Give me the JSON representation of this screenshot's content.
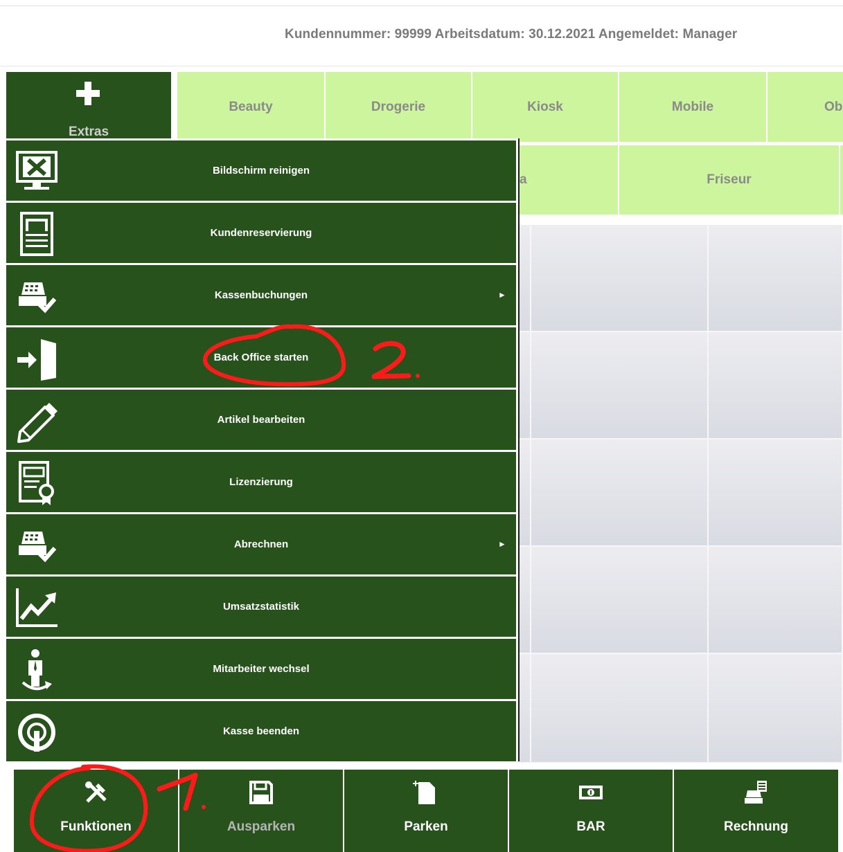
{
  "header": {
    "text": "Kundennummer: 99999 Arbeitsdatum: 30.12.2021 Angemeldet: Manager"
  },
  "extras": {
    "label": "Extras",
    "icon": "plus-icon"
  },
  "categories": {
    "row1": [
      "Beauty",
      "Drogerie",
      "Kiosk",
      "Mobile",
      "Ob"
    ],
    "row2": [
      "a",
      "Friseur"
    ]
  },
  "menu": {
    "items": [
      {
        "label": "Bildschirm reinigen",
        "icon": "screen-clean-icon"
      },
      {
        "label": "Kundenreservierung",
        "icon": "reservation-document-icon"
      },
      {
        "label": "Kassenbuchungen",
        "icon": "cash-register-check-icon",
        "submenu_arrow": "►"
      },
      {
        "label": "Back Office starten",
        "icon": "enter-door-icon"
      },
      {
        "label": "Artikel bearbeiten",
        "icon": "pencil-icon"
      },
      {
        "label": "Lizenzierung",
        "icon": "certificate-icon"
      },
      {
        "label": "Abrechnen",
        "icon": "cash-register-check-icon",
        "submenu_arrow": "►"
      },
      {
        "label": "Umsatzstatistik",
        "icon": "chart-trend-icon"
      },
      {
        "label": "Mitarbeiter wechsel",
        "icon": "employee-switch-icon"
      },
      {
        "label": "Kasse beenden",
        "icon": "power-icon"
      }
    ]
  },
  "bottom_bar": {
    "buttons": [
      {
        "label": "Funktionen",
        "icon": "tools-icon",
        "enabled": true
      },
      {
        "label": "Ausparken",
        "icon": "floppy-disk-icon",
        "enabled": false
      },
      {
        "label": "Parken",
        "icon": "new-document-icon",
        "enabled": true
      },
      {
        "label": "BAR",
        "icon": "cash-banknote-icon",
        "enabled": true
      },
      {
        "label": "Rechnung",
        "icon": "register-receipt-icon",
        "enabled": true
      }
    ]
  },
  "annotations": {
    "step1": "1.",
    "step2": "2."
  },
  "colors": {
    "dark_green": "#27521c",
    "light_green": "#cdf59e",
    "annotation_red": "#ff1a1a",
    "header_text": "#7a7a7a"
  }
}
